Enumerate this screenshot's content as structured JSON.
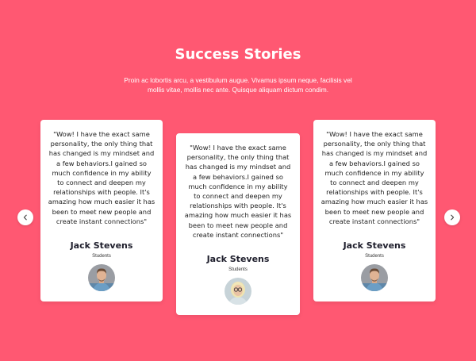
{
  "section": {
    "title": "Success Stories",
    "subtitle": "Proin ac lobortis arcu, a vestibulum augue. Vivamus ipsum neque, facilisis vel mollis vitae, mollis nec ante. Quisque aliquam dictum condim."
  },
  "testimonials": [
    {
      "quote": "\"Wow! I have the exact same personality, the only thing that has changed is my mindset and a few behaviors.I gained so much confidence in my ability to connect and deepen my relationships with people. It's amazing how much easier it has been to meet new people and create instant connections\"",
      "name": "Jack Stevens",
      "role": "Students"
    },
    {
      "quote": "\"Wow! I have the exact same personality, the only thing that has changed is my mindset and a few behaviors.I gained so much confidence in my ability to connect and deepen my relationships with people. It's amazing how much easier it has been to meet new people and create instant connections\"",
      "name": "Jack Stevens",
      "role": "Students"
    },
    {
      "quote": "\"Wow! I have the exact same personality, the only thing that has changed is my mindset and a few behaviors.I gained so much confidence in my ability to connect and deepen my relationships with people. It's amazing how much easier it has been to meet new people and create instant connections\"",
      "name": "Jack Stevens",
      "role": "Students"
    }
  ],
  "carousel": {
    "prev_icon": "chevron-left-icon",
    "next_icon": "chevron-right-icon"
  },
  "colors": {
    "background": "#ff5872",
    "card": "#ffffff",
    "name_text": "#1d1d2b"
  }
}
